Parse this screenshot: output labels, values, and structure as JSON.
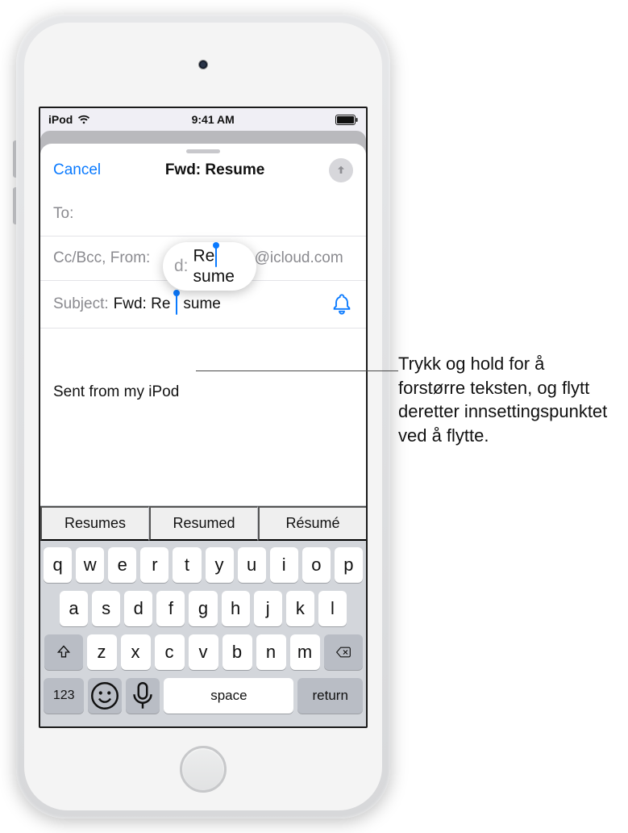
{
  "status": {
    "carrier": "iPod",
    "time": "9:41 AM"
  },
  "sheet": {
    "cancel": "Cancel",
    "title": "Fwd:  Resume",
    "to_label": "To:",
    "ccbcc_label": "Cc/Bcc, From:",
    "ccbcc_value": "rico1@icloud.com",
    "subject_label": "Subject:",
    "subject_value_before": "Fwd:  Re",
    "subject_value_after": "sume",
    "body_signature": "Sent from my iPod"
  },
  "magnifier": {
    "label": "d:",
    "before": "Re",
    "after": "sume"
  },
  "suggestions": [
    "Resumes",
    "Resumed",
    "Résumé"
  ],
  "keyboard": {
    "row1": [
      "q",
      "w",
      "e",
      "r",
      "t",
      "y",
      "u",
      "i",
      "o",
      "p"
    ],
    "row2": [
      "a",
      "s",
      "d",
      "f",
      "g",
      "h",
      "j",
      "k",
      "l"
    ],
    "row3": [
      "z",
      "x",
      "c",
      "v",
      "b",
      "n",
      "m"
    ],
    "numkey": "123",
    "space": "space",
    "return": "return"
  },
  "callout": "Trykk og hold for å forstørre teksten, og flytt deretter innsettingspunktet ved å flytte."
}
